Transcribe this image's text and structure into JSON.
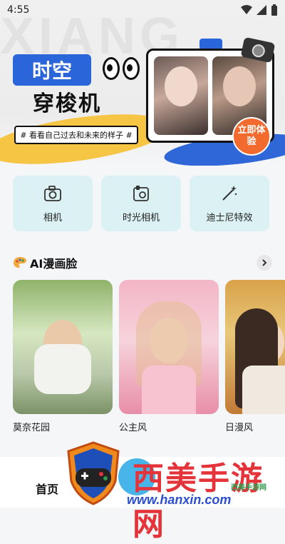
{
  "status_bar": {
    "time": "4:55"
  },
  "banner": {
    "title": "时空",
    "subtitle": "穿梭机",
    "watermark_text": "XIANG",
    "tagline": "# 看看自己过去和未来的样子 #",
    "cta": "立即体验"
  },
  "features": [
    {
      "label": "相机",
      "icon": "camera-icon"
    },
    {
      "label": "时光相机",
      "icon": "time-camera-icon"
    },
    {
      "label": "迪士尼特效",
      "icon": "magic-wand-icon"
    }
  ],
  "section": {
    "title": "AI漫画脸",
    "icon": "palette-icon"
  },
  "cards": [
    {
      "label": "莫奈花园"
    },
    {
      "label": "公主风"
    },
    {
      "label": "日漫风"
    }
  ],
  "bottom_nav": {
    "home": "首页"
  },
  "watermark": {
    "main": "西美手游网",
    "url": "www.hanxin.com",
    "small": "西美手游网"
  },
  "colors": {
    "accent_blue": "#2a66d9",
    "cta_orange": "#f26a2e",
    "feature_bg": "#dcf1f3"
  }
}
